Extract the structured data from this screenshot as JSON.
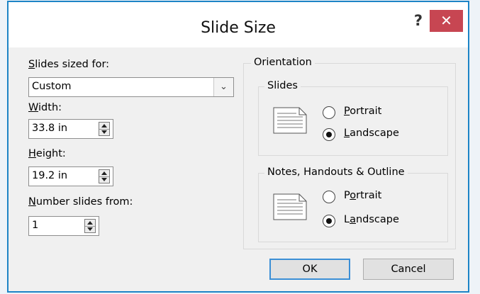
{
  "window": {
    "title": "Slide Size",
    "help_glyph": "?",
    "close_glyph": "✕"
  },
  "left": {
    "sized_for": {
      "label_mnemonic": "S",
      "label_rest": "lides sized for:",
      "value": "Custom"
    },
    "width": {
      "label_mnemonic": "W",
      "label_rest": "idth:",
      "value": "33.8 in"
    },
    "height": {
      "label_mnemonic": "H",
      "label_rest": "eight:",
      "value": "19.2 in"
    },
    "number_from": {
      "label_mnemonic": "N",
      "label_rest": "umber slides from:",
      "value": "1"
    }
  },
  "orientation": {
    "title": "Orientation",
    "slides": {
      "title": "Slides",
      "portrait_label": "Portrait",
      "portrait_mnemonic": "P",
      "landscape_label": "Landscape",
      "landscape_mnemonic": "L",
      "selected": "landscape"
    },
    "notes": {
      "title": "Notes, Handouts & Outline",
      "portrait_label": "Portrait",
      "portrait_mnemonic": "o",
      "landscape_label": "Landscape",
      "landscape_mnemonic": "a",
      "selected": "landscape"
    }
  },
  "buttons": {
    "ok": "OK",
    "cancel": "Cancel"
  },
  "colors": {
    "accent": "#1d84c6",
    "close_bg": "#c74652",
    "dialog_bg": "#f0f0f0"
  }
}
